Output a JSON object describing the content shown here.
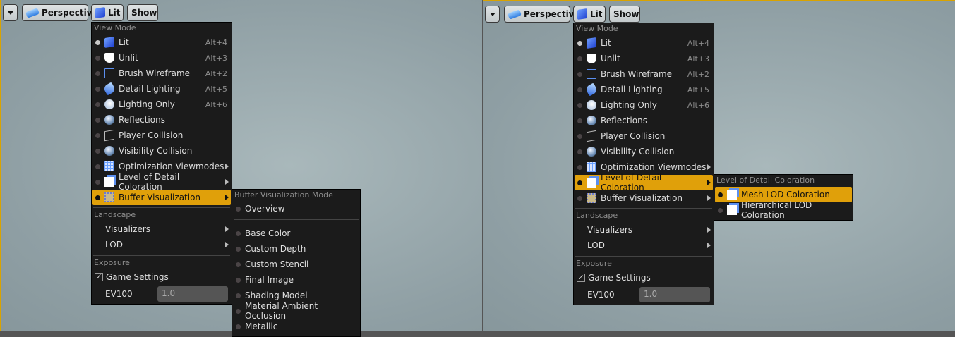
{
  "toolbar": {
    "perspective": "Perspective",
    "lit": "Lit",
    "show": "Show"
  },
  "view_mode": {
    "header": "View Mode",
    "items": [
      {
        "label": "Lit",
        "shortcut": "Alt+4",
        "icon": "cube"
      },
      {
        "label": "Unlit",
        "shortcut": "Alt+3",
        "icon": "shield"
      },
      {
        "label": "Brush Wireframe",
        "shortcut": "Alt+2",
        "icon": "wire"
      },
      {
        "label": "Detail Lighting",
        "shortcut": "Alt+5",
        "icon": "torch"
      },
      {
        "label": "Lighting Only",
        "shortcut": "Alt+6",
        "icon": "bulb"
      },
      {
        "label": "Reflections",
        "shortcut": "",
        "icon": "sphere"
      },
      {
        "label": "Player Collision",
        "shortcut": "",
        "icon": "box"
      },
      {
        "label": "Visibility Collision",
        "shortcut": "",
        "icon": "sphere"
      },
      {
        "label": "Optimization Viewmodes",
        "shortcut": "",
        "icon": "grid",
        "sub": true
      },
      {
        "label": "Level of Detail Coloration",
        "shortcut": "",
        "icon": "lod",
        "sub": true
      },
      {
        "label": "Buffer Visualization",
        "shortcut": "",
        "icon": "buf",
        "sub": true
      }
    ]
  },
  "landscape": {
    "header": "Landscape",
    "items": [
      "Visualizers",
      "LOD"
    ]
  },
  "exposure": {
    "header": "Exposure",
    "game_settings": "Game Settings",
    "game_settings_checked": true,
    "ev100_label": "EV100",
    "ev100_value": "1.0"
  },
  "buffer_submenu": {
    "header": "Buffer Visualization Mode",
    "overview": "Overview",
    "items": [
      "Base Color",
      "Custom Depth",
      "Custom Stencil",
      "Final Image",
      "Shading Model",
      "Material Ambient Occlusion",
      "Metallic"
    ]
  },
  "lod_submenu": {
    "header": "Level of Detail Coloration",
    "items": [
      "Mesh LOD Coloration",
      "Hierarchical LOD Coloration"
    ]
  },
  "left_highlight": "Buffer Visualization",
  "right_highlight": "Level of Detail Coloration",
  "active_color": "#e0a00a"
}
